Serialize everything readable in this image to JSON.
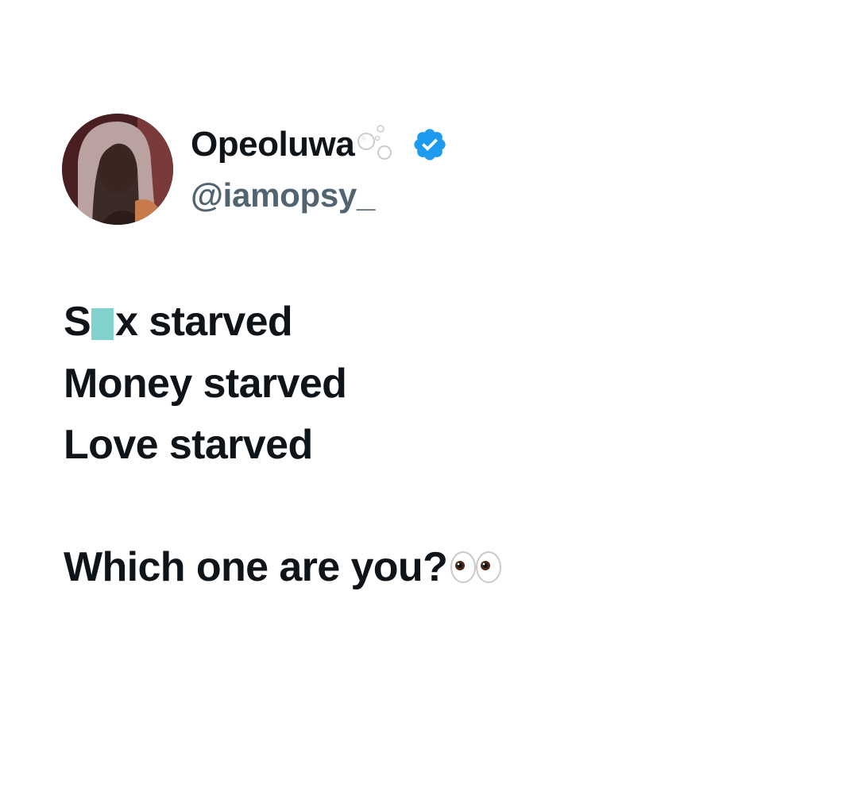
{
  "author": {
    "display_name": "Opeoluwa",
    "handle": "@iamopsy_",
    "verified": true,
    "name_decoration_icon": "bubbles-icon",
    "badge_icon": "verified-badge-icon",
    "badge_color": "#1d9bf0"
  },
  "tweet": {
    "line1_prefix": "S",
    "line1_suffix": "x starved",
    "line2": "Money starved",
    "line3": "Love starved",
    "line5": "Which one are you?",
    "trailing_emoji_icon": "eyes-icon",
    "censor_color": "#7fd3cc"
  }
}
